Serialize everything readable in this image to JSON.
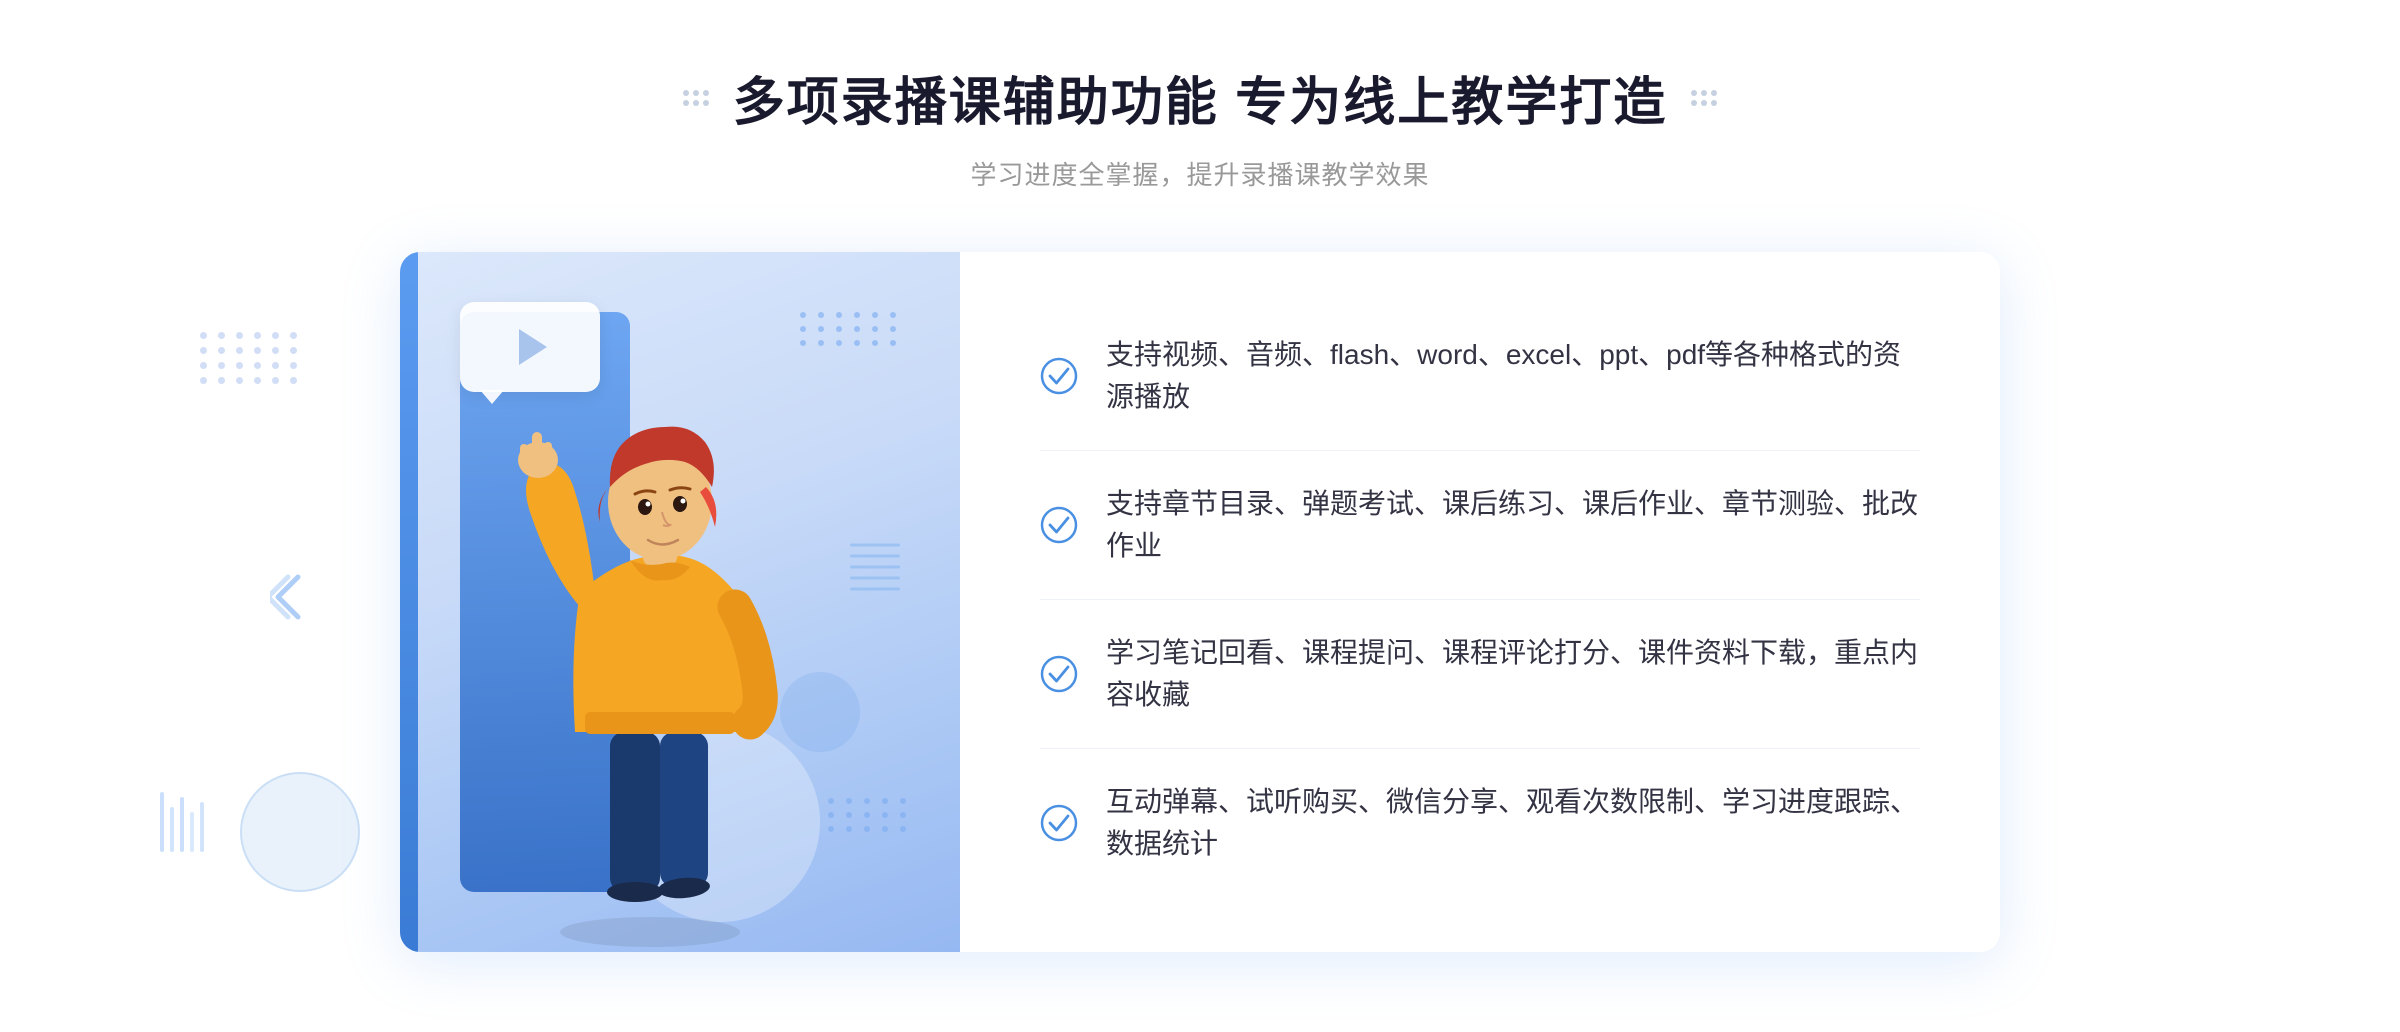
{
  "header": {
    "title": "多项录播课辅助功能 专为线上教学打造",
    "subtitle": "学习进度全掌握，提升录播课教学效果",
    "decoration_left": "⠿",
    "decoration_right": "⠿"
  },
  "features": [
    {
      "id": 1,
      "text": "支持视频、音频、flash、word、excel、ppt、pdf等各种格式的资源播放"
    },
    {
      "id": 2,
      "text": "支持章节目录、弹题考试、课后练习、课后作业、章节测验、批改作业"
    },
    {
      "id": 3,
      "text": "学习笔记回看、课程提问、课程评论打分、课件资料下载，重点内容收藏"
    },
    {
      "id": 4,
      "text": "互动弹幕、试听购买、微信分享、观看次数限制、学习进度跟踪、数据统计"
    }
  ],
  "colors": {
    "accent_blue": "#4a90e2",
    "light_blue": "#5b9bf0",
    "bg_gradient_start": "#dce8fb",
    "bg_gradient_end": "#96b8f2",
    "text_dark": "#333344",
    "text_light": "#999999",
    "check_color": "#4a90e2"
  }
}
